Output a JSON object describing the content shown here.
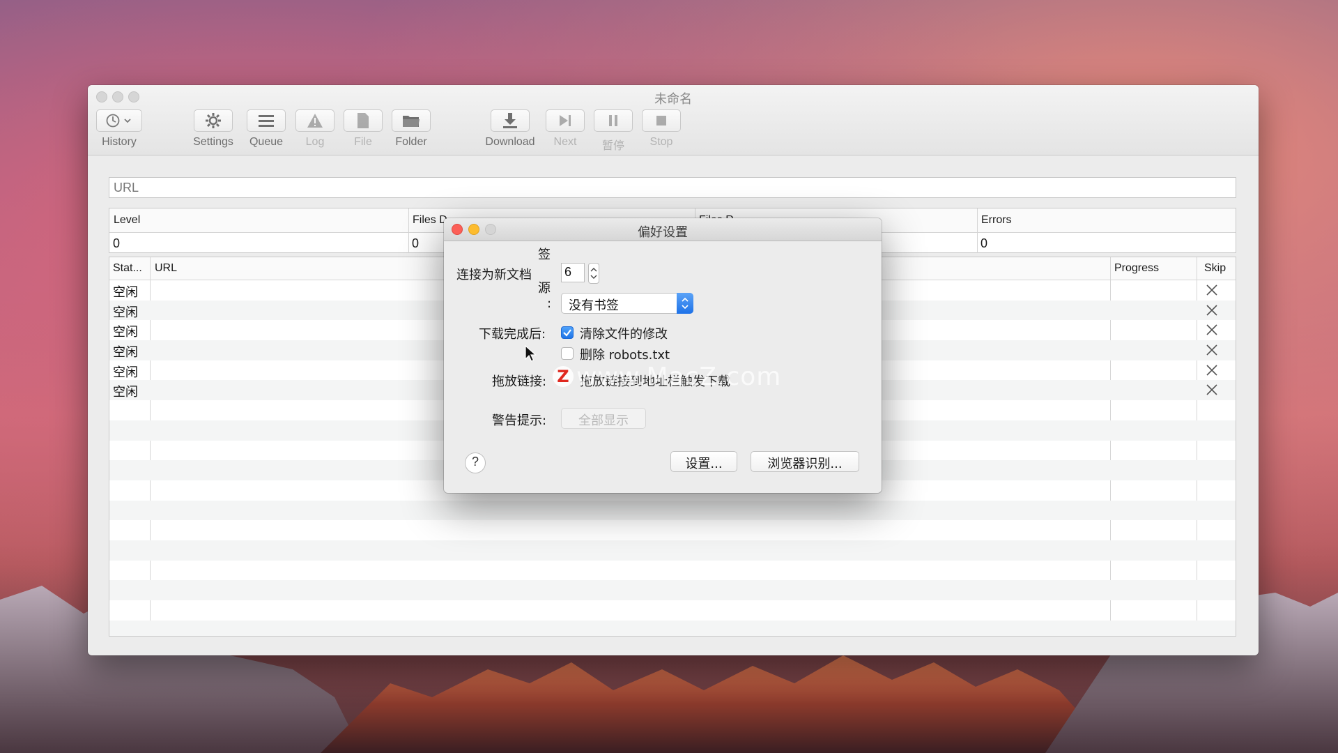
{
  "window": {
    "title": "未命名"
  },
  "toolbar": {
    "history": "History",
    "settings": "Settings",
    "queue": "Queue",
    "log": "Log",
    "file": "File",
    "folder": "Folder",
    "download": "Download",
    "next": "Next",
    "pause": "暂停",
    "stop": "Stop"
  },
  "url_field": {
    "placeholder": "URL"
  },
  "stats": {
    "headers": [
      "Level",
      "Files D",
      "Files R",
      "Errors"
    ],
    "values": [
      "0",
      "0",
      "0"
    ]
  },
  "list": {
    "headers": {
      "status": "Stat...",
      "url": "URL",
      "progress": "Progress",
      "skip": "Skip"
    },
    "rows": [
      {
        "status": "空闲"
      },
      {
        "status": "空闲"
      },
      {
        "status": "空闲"
      },
      {
        "status": "空闲"
      },
      {
        "status": "空闲"
      },
      {
        "status": "空闲"
      }
    ]
  },
  "dialog": {
    "title": "偏好设置",
    "connect_label": "连接为新文档",
    "connect_value": "6",
    "bookmark_label_lines": [
      "签",
      "源",
      ":"
    ],
    "bookmark_value": "没有书签",
    "after_download_label": "下载完成后:",
    "option_clear": "清除文件的修改",
    "option_clear_checked": true,
    "option_robots": "删除 robots.txt",
    "option_robots_checked": false,
    "drag_label": "拖放链接:",
    "drag_value": "拖放链接到地址栏触发下载",
    "warning_label": "警告提示:",
    "show_all": "全部显示",
    "help": "?",
    "settings_button": "设置...",
    "browser_button": "浏览器识别..."
  },
  "watermark": {
    "badge": "Z",
    "text": "www.MacZ.com"
  },
  "colors": {
    "close": "#fc5f57",
    "minimize": "#fdbc2e",
    "accent": "#1f74e6"
  }
}
